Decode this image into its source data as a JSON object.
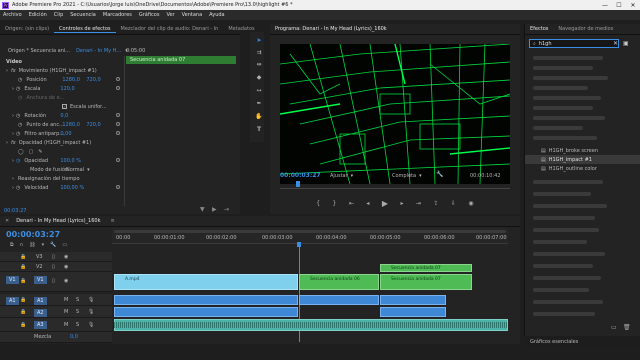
{
  "window": {
    "title": "Adobe Premiere Pro 2021 - C:\\Usuarios\\Jorge luis\\OneDrive\\Documentos\\Adobe\\Premiere Pro\\13.0\\highlight #6 *",
    "app_icon": "Pr",
    "min": "—",
    "max": "☐",
    "close": "✕"
  },
  "menu": [
    "Archivo",
    "Edición",
    "Clip",
    "Secuencia",
    "Marcadores",
    "Gráficos",
    "Ver",
    "Ventana",
    "Ayuda"
  ],
  "effect_controls": {
    "tabs": [
      "Origen: (sin clips)",
      "Controles de efectos",
      "Mezclador del clip de audio: Denari - In",
      "Metadatos"
    ],
    "source": "Origen * Secuencia ani...",
    "sequence": "Denari - In My H...",
    "ruler_time": "0:05:00",
    "clip_name": "Secuencia anidada 07",
    "section_video": "Vídeo",
    "motion_label": "Movimiento (H1GH_impact #1)",
    "position_label": "Posición",
    "position_x": "1280,0",
    "position_y": "720,0",
    "scale_label": "Escala",
    "scale_value": "120,0",
    "scale_width_label": "Anchura de e...",
    "uniform_scale_label": "Escala unifor...",
    "rotation_label": "Rotación",
    "rotation_value": "0,0",
    "anchor_label": "Punto de anc...",
    "anchor_x": "1280,0",
    "anchor_y": "720,0",
    "flicker_label": "Filtro antiparp...",
    "flicker_value": "0,00",
    "opacity_label": "Opacidad (H1GH_impact #1)",
    "opacity_sub_label": "Opacidad",
    "opacity_value": "100,0 %",
    "blend_label": "Modo de fusión",
    "blend_value": "Normal",
    "time_remap_label": "Reasignación del tiempo",
    "speed_label": "Velocidad",
    "speed_value": "100,00 %",
    "timecode": "00:03:27"
  },
  "program": {
    "title": "Programa: Denari - In My Head (Lyrics)_160k",
    "timecode": "00:00:03:27",
    "fit": "Ajustar",
    "quality": "Completa",
    "duration": "00:00:10:42",
    "image_color": "#00ff4a"
  },
  "effects": {
    "tabs": [
      "Efectos",
      "Navegador de medios"
    ],
    "search_value": "h1gh",
    "items": [
      "H1GH_broke screen",
      "H1GH_impact #1",
      "H1GH_outline color"
    ],
    "footer": "Gráficos esenciales"
  },
  "timeline": {
    "title": "Denari - In My Head (Lyrics)_160k",
    "timecode": "00:00:03:27",
    "ruler": [
      "00:00",
      "00:00:01:00",
      "00:00:02:00",
      "00:00:03:00",
      "00:00:04:00",
      "00:00:05:00",
      "00:00:06:00",
      "00:00:07:00"
    ],
    "video_tracks": [
      "V3",
      "V2",
      "V1"
    ],
    "audio_tracks": [
      "A1",
      "A2",
      "A3"
    ],
    "source_v": "V1",
    "source_a": "A1",
    "mix_label": "Mezcla",
    "mix_value": "0,0",
    "clips": {
      "v1_clip": "A.mp4",
      "v1_seq06": "Secuencia anidada 06",
      "v1_seq07": "Secuencia anidada 07",
      "v2_seq07": "Secuencia anidada 07"
    }
  },
  "accent": "#3a8ee6"
}
